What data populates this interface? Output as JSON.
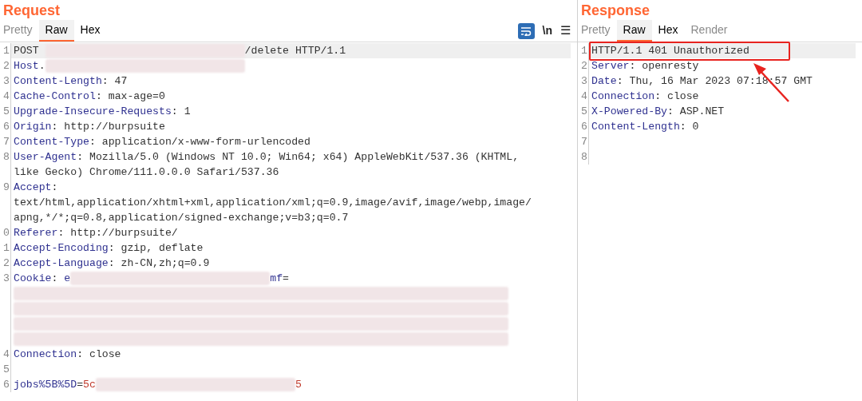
{
  "request": {
    "title": "Request",
    "tabs": [
      {
        "label": "Pretty",
        "selected": false,
        "disabled": true
      },
      {
        "label": "Raw",
        "selected": true,
        "disabled": false
      },
      {
        "label": "Hex",
        "selected": false,
        "disabled": false
      }
    ],
    "toolbar": {
      "wrap_on": true,
      "newline": "\\n",
      "menu": "☰"
    },
    "lines": [
      {
        "num": "1",
        "highlighted": true,
        "rows": [
          [
            {
              "kind": "text",
              "text": "POST "
            },
            {
              "kind": "redacted"
            },
            {
              "kind": "text",
              "text": "/delete HTTP/1.1"
            }
          ]
        ]
      },
      {
        "num": "2",
        "highlighted": false,
        "rows": [
          [
            {
              "kind": "key",
              "text": "Host"
            },
            {
              "kind": "text",
              "text": "."
            },
            {
              "kind": "redacted"
            }
          ]
        ]
      },
      {
        "num": "3",
        "highlighted": false,
        "rows": [
          [
            {
              "kind": "key",
              "text": "Content-Length"
            },
            {
              "kind": "text",
              "text": ": 47"
            }
          ]
        ]
      },
      {
        "num": "4",
        "highlighted": false,
        "rows": [
          [
            {
              "kind": "key",
              "text": "Cache-Control"
            },
            {
              "kind": "text",
              "text": ": max-age=0"
            }
          ]
        ]
      },
      {
        "num": "5",
        "highlighted": false,
        "rows": [
          [
            {
              "kind": "key",
              "text": "Upgrade-Insecure-Requests"
            },
            {
              "kind": "text",
              "text": ": 1"
            }
          ]
        ]
      },
      {
        "num": "6",
        "highlighted": false,
        "rows": [
          [
            {
              "kind": "key",
              "text": "Origin"
            },
            {
              "kind": "text",
              "text": ": http://burpsuite"
            }
          ]
        ]
      },
      {
        "num": "7",
        "highlighted": false,
        "rows": [
          [
            {
              "kind": "key",
              "text": "Content-Type"
            },
            {
              "kind": "text",
              "text": ": application/x-www-form-urlencoded"
            }
          ]
        ]
      },
      {
        "num": "8",
        "highlighted": false,
        "rows": [
          [
            {
              "kind": "key",
              "text": "User-Agent"
            },
            {
              "kind": "text",
              "text": ": Mozilla/5.0 (Windows NT 10.0; Win64; x64) AppleWebKit/537.36 (KHTML,"
            }
          ],
          [
            {
              "kind": "text",
              "text": "like Gecko) Chrome/111.0.0.0 Safari/537.36"
            }
          ]
        ]
      },
      {
        "num": "9",
        "highlighted": false,
        "rows": [
          [
            {
              "kind": "key",
              "text": "Accept"
            },
            {
              "kind": "text",
              "text": ":"
            }
          ],
          [
            {
              "kind": "text",
              "text": "text/html,application/xhtml+xml,application/xml;q=0.9,image/avif,image/webp,image/"
            }
          ],
          [
            {
              "kind": "text",
              "text": "apng,*/*;q=0.8,application/signed-exchange;v=b3;q=0.7"
            }
          ]
        ]
      },
      {
        "num": "0",
        "highlighted": false,
        "rows": [
          [
            {
              "kind": "key",
              "text": "Referer"
            },
            {
              "kind": "text",
              "text": ": http://burpsuite/"
            }
          ]
        ]
      },
      {
        "num": "1",
        "highlighted": false,
        "rows": [
          [
            {
              "kind": "key",
              "text": "Accept-Encoding"
            },
            {
              "kind": "text",
              "text": ": gzip, deflate"
            }
          ]
        ]
      },
      {
        "num": "2",
        "highlighted": false,
        "rows": [
          [
            {
              "kind": "key",
              "text": "Accept-Language"
            },
            {
              "kind": "text",
              "text": ": zh-CN,zh;q=0.9"
            }
          ]
        ]
      },
      {
        "num": "3",
        "highlighted": false,
        "rows": [
          [
            {
              "kind": "key",
              "text": "Cookie"
            },
            {
              "kind": "text",
              "text": ": "
            },
            {
              "kind": "key",
              "text": "e"
            },
            {
              "kind": "redacted"
            },
            {
              "kind": "key",
              "text": "mf"
            },
            {
              "kind": "text",
              "text": "="
            }
          ],
          [
            {
              "kind": "redacted"
            }
          ],
          [
            {
              "kind": "redacted"
            }
          ],
          [
            {
              "kind": "redacted"
            }
          ],
          [
            {
              "kind": "redacted"
            }
          ]
        ]
      },
      {
        "num": "4",
        "highlighted": false,
        "rows": [
          [
            {
              "kind": "key",
              "text": "Connection"
            },
            {
              "kind": "text",
              "text": ": close"
            }
          ]
        ]
      },
      {
        "num": "5",
        "highlighted": false,
        "rows": [
          []
        ]
      },
      {
        "num": "6",
        "highlighted": false,
        "rows": [
          [
            {
              "kind": "param",
              "text": "jobs%5B%5D"
            },
            {
              "kind": "text",
              "text": "="
            },
            {
              "kind": "param_value",
              "text": "5c"
            },
            {
              "kind": "redacted"
            },
            {
              "kind": "param_value",
              "text": "5"
            }
          ]
        ]
      }
    ]
  },
  "response": {
    "title": "Response",
    "tabs": [
      {
        "label": "Pretty",
        "selected": false,
        "disabled": true
      },
      {
        "label": "Raw",
        "selected": true,
        "disabled": false
      },
      {
        "label": "Hex",
        "selected": false,
        "disabled": false
      },
      {
        "label": "Render",
        "selected": false,
        "disabled": true
      }
    ],
    "lines": [
      {
        "num": "1",
        "highlighted": true,
        "boxed": true,
        "rows": [
          [
            {
              "kind": "text",
              "text": "HTTP/1.1 401 Unauthorized"
            }
          ]
        ]
      },
      {
        "num": "2",
        "highlighted": false,
        "rows": [
          [
            {
              "kind": "key",
              "text": "Server"
            },
            {
              "kind": "text",
              "text": ": openresty"
            }
          ]
        ]
      },
      {
        "num": "3",
        "highlighted": false,
        "rows": [
          [
            {
              "kind": "key",
              "text": "Date"
            },
            {
              "kind": "text",
              "text": ": Thu, 16 Mar 2023 07:18:57 GMT"
            }
          ]
        ]
      },
      {
        "num": "4",
        "highlighted": false,
        "rows": [
          [
            {
              "kind": "key",
              "text": "Connection"
            },
            {
              "kind": "text",
              "text": ": close"
            }
          ]
        ]
      },
      {
        "num": "5",
        "highlighted": false,
        "rows": [
          [
            {
              "kind": "key",
              "text": "X-Powered-By"
            },
            {
              "kind": "text",
              "text": ": ASP.NET"
            }
          ]
        ]
      },
      {
        "num": "6",
        "highlighted": false,
        "rows": [
          [
            {
              "kind": "key",
              "text": "Content-Length"
            },
            {
              "kind": "text",
              "text": ": 0"
            }
          ]
        ]
      },
      {
        "num": "7",
        "highlighted": false,
        "rows": [
          []
        ]
      },
      {
        "num": "8",
        "highlighted": false,
        "rows": [
          []
        ]
      }
    ]
  }
}
